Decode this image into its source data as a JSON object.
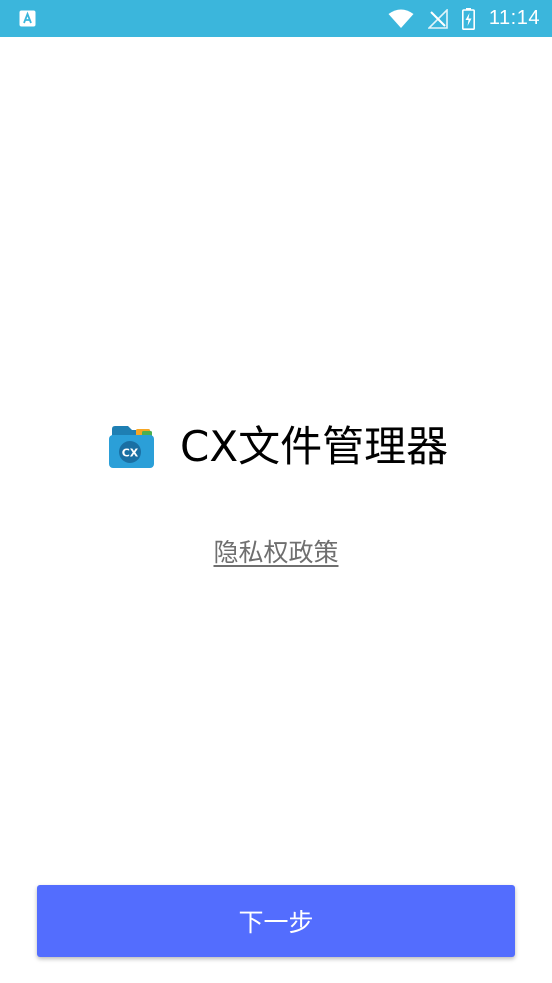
{
  "status_bar": {
    "time": "11:14",
    "left_icon": "keyboard-a-icon",
    "icons": [
      "wifi-icon",
      "no-signal-icon",
      "battery-charging-icon"
    ],
    "background_color": "#3bb6dc"
  },
  "app": {
    "title": "CX文件管理器",
    "logo_text": "CX",
    "logo_icon": "folder-icon"
  },
  "privacy_link": "隐私权政策",
  "next_button": {
    "label": "下一步",
    "color": "#536dfe"
  }
}
